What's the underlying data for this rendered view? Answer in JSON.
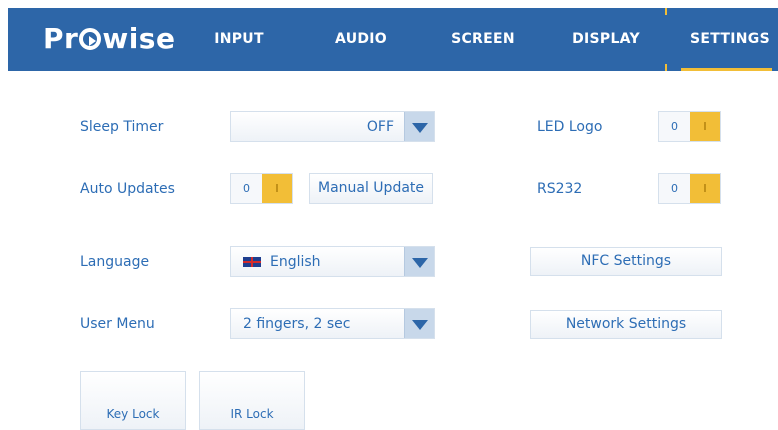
{
  "header": {
    "logo": "Prowise",
    "tabs": [
      {
        "label": "INPUT",
        "active": false
      },
      {
        "label": "AUDIO",
        "active": false
      },
      {
        "label": "SCREEN",
        "active": false
      },
      {
        "label": "DISPLAY",
        "active": false
      },
      {
        "label": "SETTINGS",
        "active": true
      }
    ]
  },
  "colors": {
    "bar": "#2d66a8",
    "accent": "#f2be37",
    "text": "#2d6db5"
  },
  "settings": {
    "sleep_timer": {
      "label": "Sleep Timer",
      "value": "OFF"
    },
    "led_logo": {
      "label": "LED Logo",
      "off": "0",
      "on": "I",
      "state": "on"
    },
    "auto_updates": {
      "label": "Auto Updates",
      "off": "0",
      "on": "I",
      "state": "on"
    },
    "manual_update": {
      "label": "Manual Update"
    },
    "rs232": {
      "label": "RS232",
      "off": "0",
      "on": "I",
      "state": "on"
    },
    "language": {
      "label": "Language",
      "value": "English",
      "flag": "uk-flag-icon"
    },
    "nfc_settings": {
      "label": "NFC Settings"
    },
    "user_menu": {
      "label": "User Menu",
      "value": "2 fingers, 2 sec"
    },
    "network_settings": {
      "label": "Network Settings"
    },
    "key_lock": {
      "label": "Key Lock"
    },
    "ir_lock": {
      "label": "IR Lock"
    }
  }
}
